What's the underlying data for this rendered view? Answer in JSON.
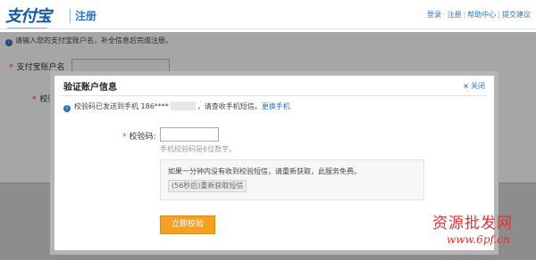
{
  "header": {
    "logo_text": "支付宝",
    "register_label": "注册",
    "links": [
      "登录",
      "注册",
      "帮助中心",
      "提交建议"
    ]
  },
  "background_form": {
    "info_text": "请输入您的支付宝账户名，补全信息后完成注册。",
    "account_label": "支付宝账户名",
    "partial_label": "校验"
  },
  "dialog": {
    "title": "验证账户信息",
    "close_label": "关闭",
    "sent_prefix": "校验码已发送到手机 186****",
    "sent_suffix": "，请查收手机短信。",
    "change_phone_link": "更换手机",
    "code_label": "校验码:",
    "code_value": "",
    "code_hint": "手机校验码是6位数字。",
    "notice_text": "如果一分钟内没有收到校验短信，请重新获取，此服务免费。",
    "resend_button": "(56秒后)重新获取短信",
    "verify_button": "立即校验"
  },
  "watermark": {
    "line1": "资源批发网",
    "line2": "www.6pf.cn"
  },
  "colors": {
    "link_blue": "#2b74c4",
    "required_red": "#e4393c",
    "button_orange": "#f5a020"
  },
  "icons": [
    "info-icon",
    "close-icon"
  ]
}
